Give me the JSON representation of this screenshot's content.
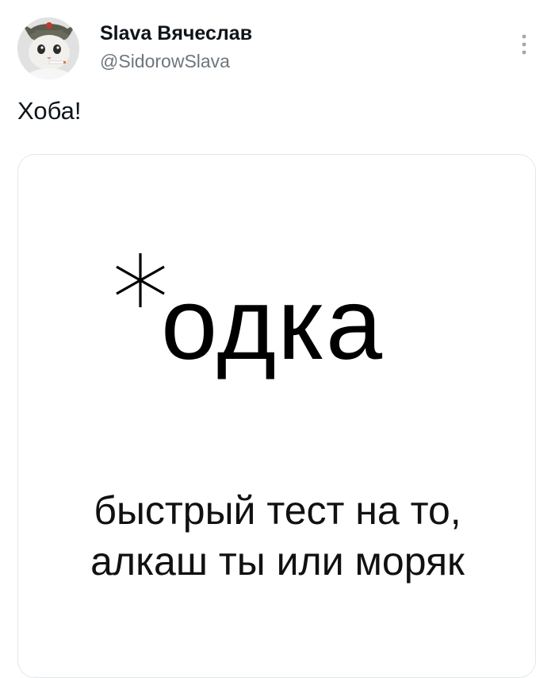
{
  "tweet": {
    "author": {
      "display_name": "Slava Вячеслав",
      "handle": "@SidorowSlava",
      "avatar_icon": "cat-soldier-avatar-icon"
    },
    "more_icon": "vertical-ellipsis-icon",
    "text": "Хоба!",
    "media": {
      "meme_symbol": "asterisk",
      "meme_word": "одка",
      "caption_line_1": "быстрый тест на то,",
      "caption_line_2": "алкаш ты или моряк"
    }
  },
  "colors": {
    "text_primary": "#0f1419",
    "text_secondary": "#6e767d",
    "card_border": "#e3e6e8",
    "background": "#ffffff"
  }
}
